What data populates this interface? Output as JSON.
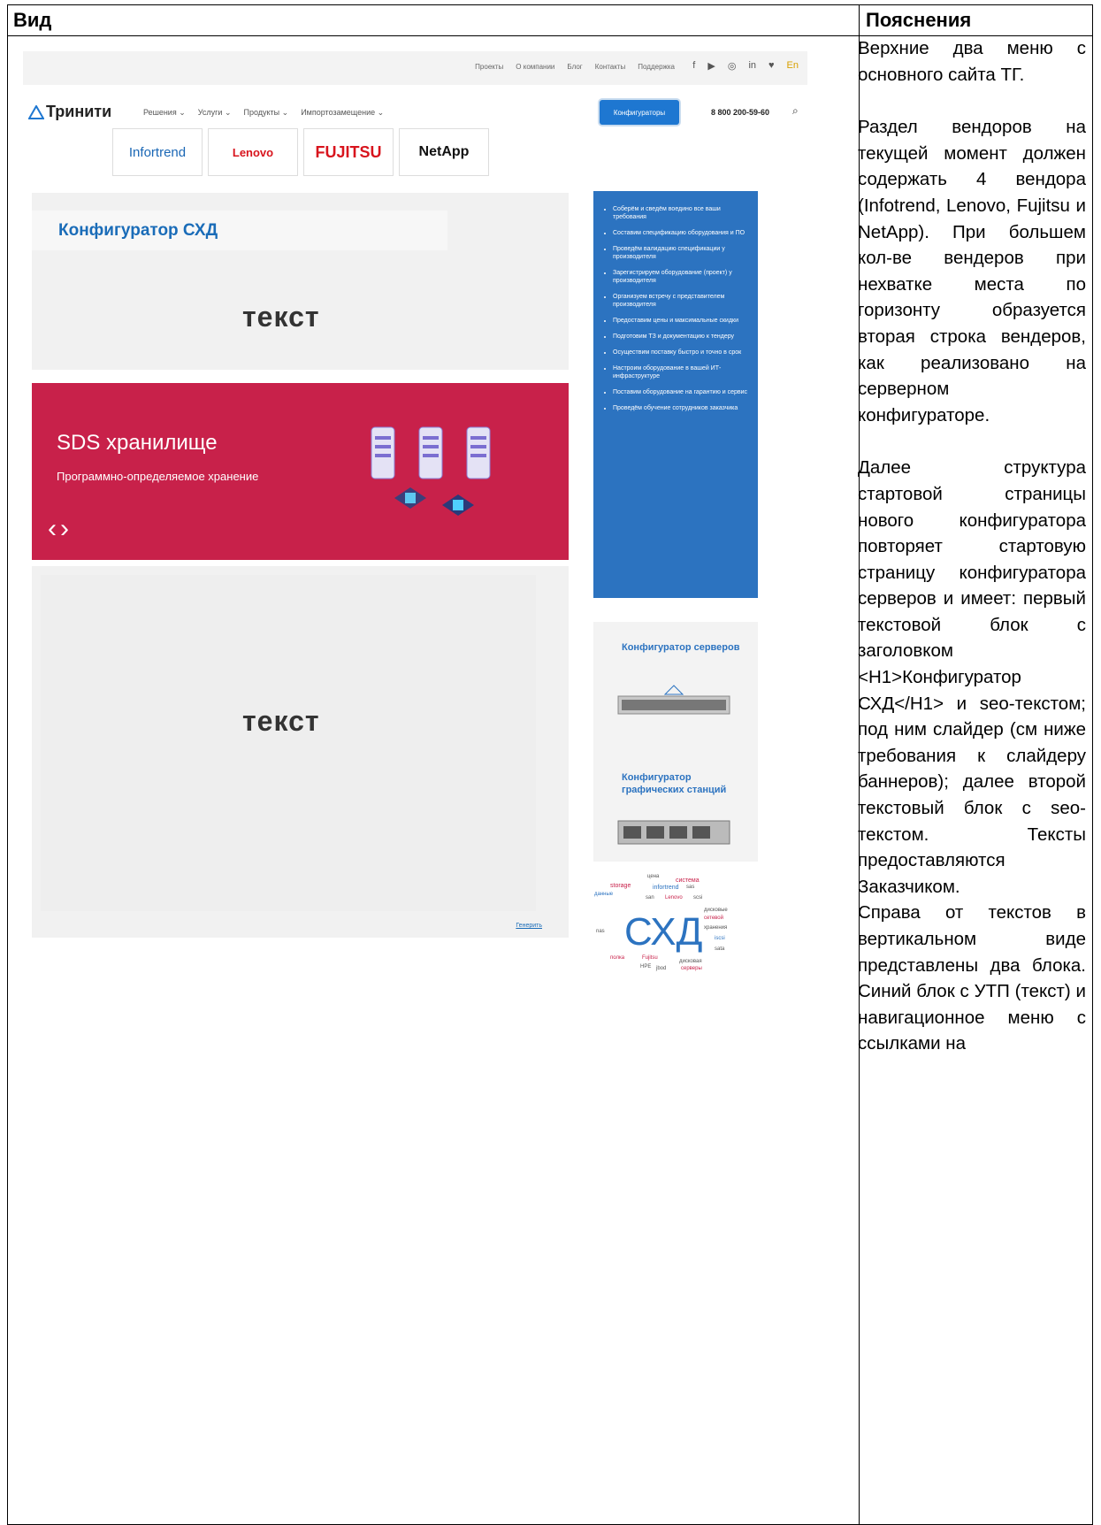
{
  "table": {
    "header_left": "Вид",
    "header_right": "Пояснения"
  },
  "explanation": {
    "p1": "Верхние два меню с основного сайта ТГ.",
    "p2": "Раздел вендоров на текущей момент должен содержать 4 вендора (Infotrend, Lenovo, Fujitsu и NetApp). При большем кол-ве вендеров при нехватке места по горизонту образуется вторая строка вендеров, как реализовано на серверном конфигураторе.",
    "p3": "Далее структура стартовой страницы нового конфигуратора повторяет стартовую страницу конфигуратора серверов и имеет: первый текстовой блок с заголовком <H1>Конфигуратор СХД</H1> и seo-текстом; под ним слайдер (см ниже требования к слайдеру баннеров); далее второй текстовый блок с seo-текстом. Тексты предоставляются Заказчиком.",
    "p4": "Справа от текстов в вертикальном виде представлены два блока. Синий блок с УТП (текст) и навигационное меню с ссылками на"
  },
  "mockup": {
    "topbar_links": [
      "Проекты",
      "О компании",
      "Блог",
      "Контакты",
      "Поддержка"
    ],
    "social_icons": [
      "facebook-icon",
      "youtube-icon",
      "instagram-icon",
      "linkedin-icon",
      "twitter-icon"
    ],
    "social_glyphs": [
      "f",
      "▶",
      "◎",
      "in",
      "♥"
    ],
    "lang": "En",
    "logo": "Тринити",
    "menu": [
      "Решения ⌄",
      "Услуги ⌄",
      "Продукты ⌄",
      "Импортозамещение ⌄"
    ],
    "configurators_button": "Конфигураторы",
    "phone": "8 800 200-59-60",
    "search_glyph": "⌕",
    "vendors": [
      "Infortrend",
      "Lenovo",
      "FUJITSU",
      "NetApp"
    ],
    "h1": "Конфигуратор СХД",
    "text_placeholder": "текст",
    "banner": {
      "title": "SDS хранилище",
      "subtitle": "Программно-определяемое хранение",
      "arrows": "‹›"
    },
    "text2_link": "Генерить",
    "utp_items": [
      "Соберём и сведём воедино все ваши требования",
      "Составим спецификацию оборудования и ПО",
      "Проведём валидацию спецификации у производителя",
      "Зарегистрируем оборудование (проект) у производителя",
      "Организуем встречу с представителем производителя",
      "Предоставим цены и максимальные скидки",
      "Подготовим ТЗ и документацию к тендеру",
      "Осуществим поставку быстро и точно в срок",
      "Настроим оборудование в вашей ИТ-инфраструктуре",
      "Поставим оборудование на гарантию и сервис",
      "Проведём обучение сотрудников заказчика"
    ],
    "card1_title": "Конфигуратор серверов",
    "card2_title": "Конфигуратор графических станций",
    "cloud_words": [
      "цена",
      "система",
      "storage",
      "infortrend",
      "sas",
      "данные",
      "san",
      "Lenovo",
      "scsi",
      "дисковые",
      "сетевой",
      "nas",
      "СХД",
      "хранения",
      "iscsi",
      "sata",
      "полка",
      "Fujitsu",
      "дисковая",
      "HPE",
      "jbod",
      "серверы"
    ]
  }
}
